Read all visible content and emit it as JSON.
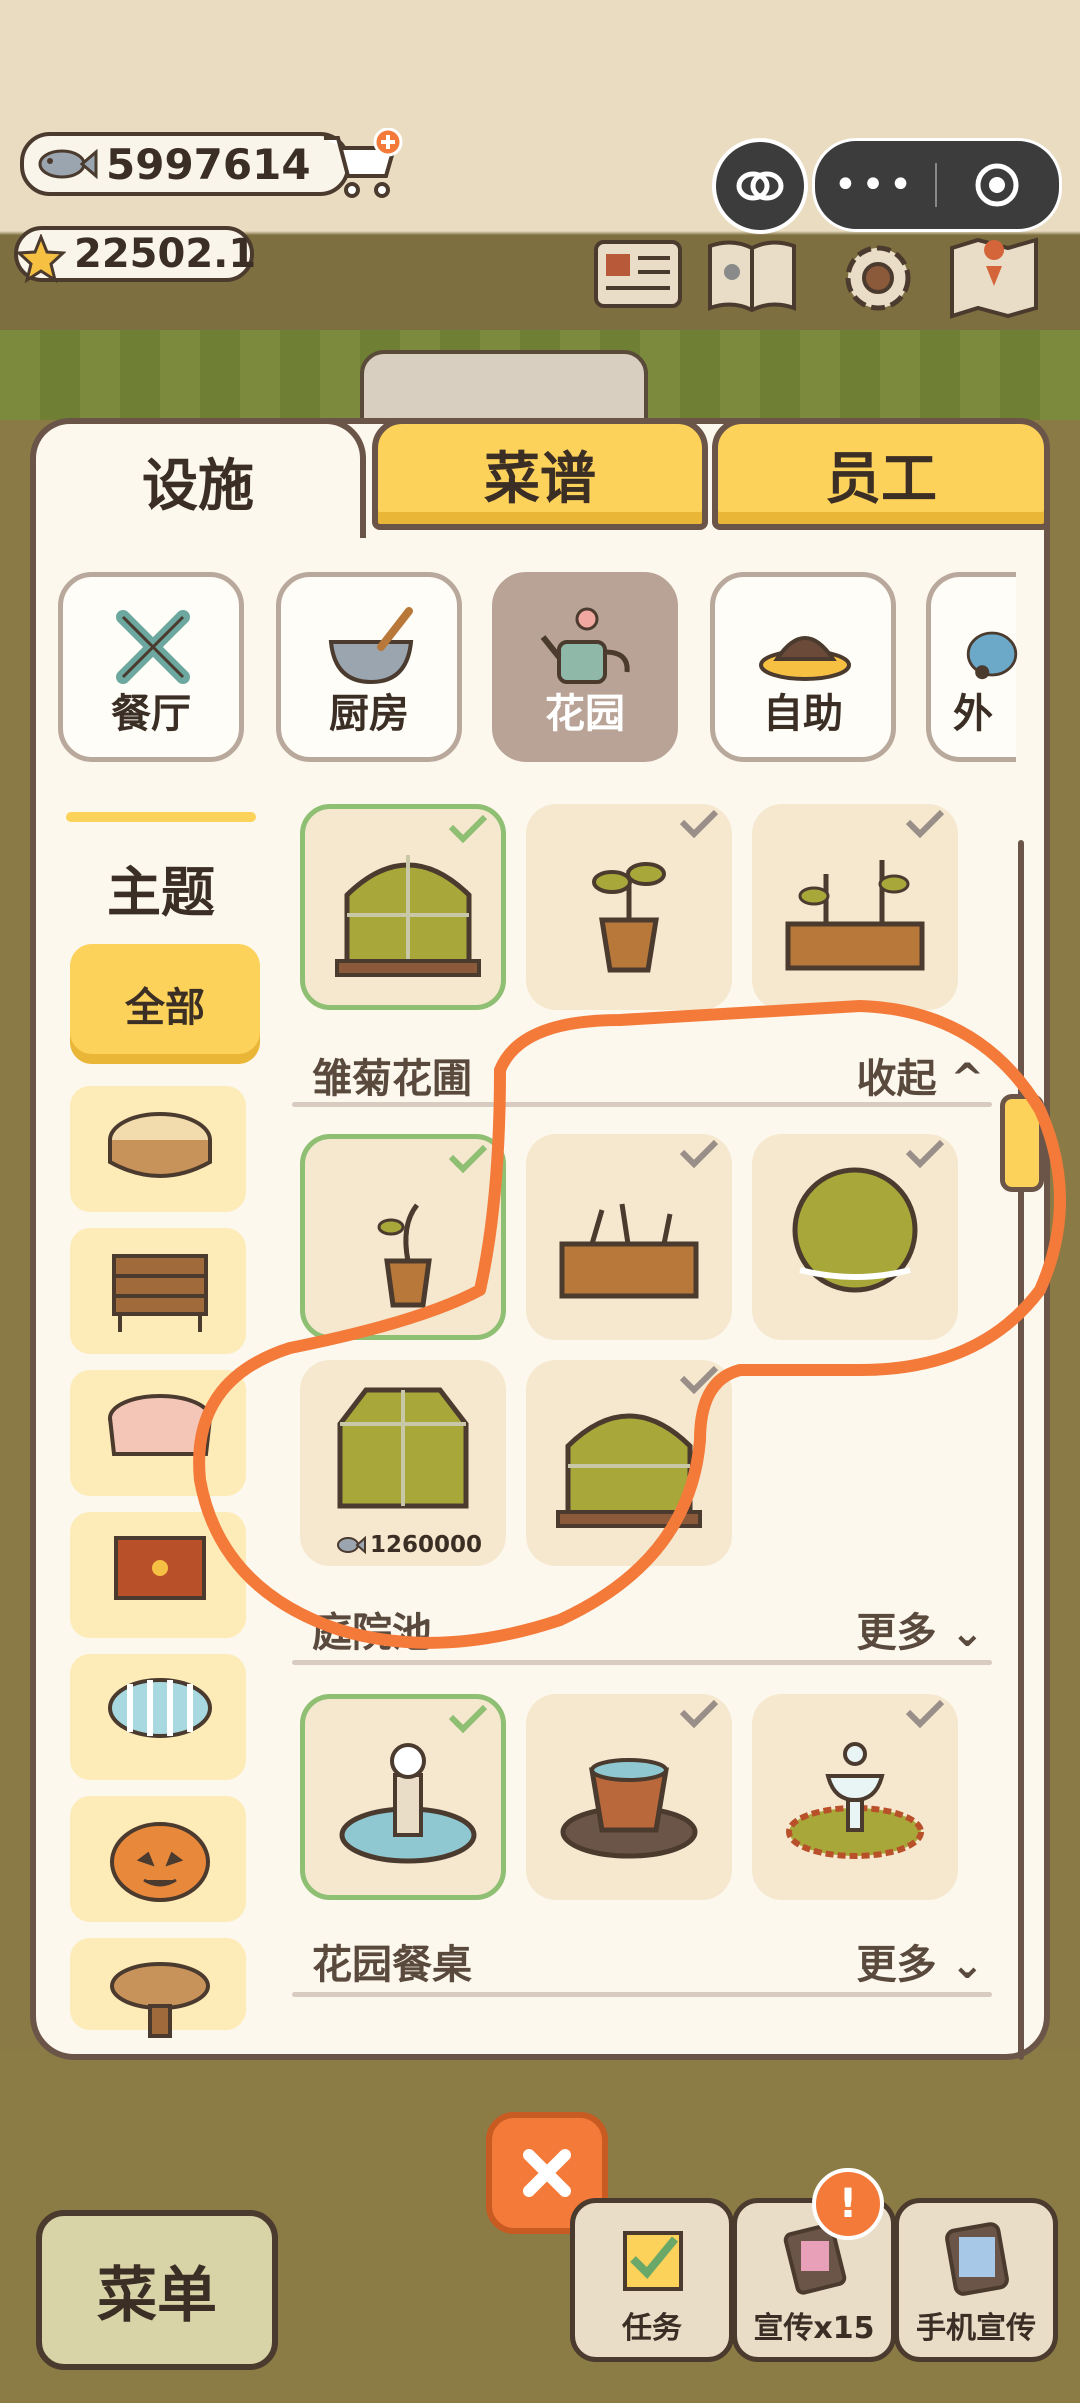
{
  "hud": {
    "currency_value": "5997614",
    "stars_value": "22502.1"
  },
  "tabs": [
    {
      "label": "设施",
      "active": true
    },
    {
      "label": "菜谱",
      "active": false
    },
    {
      "label": "员工",
      "active": false
    }
  ],
  "categories": [
    {
      "label": "餐厅",
      "selected": false
    },
    {
      "label": "厨房",
      "selected": false
    },
    {
      "label": "花园",
      "selected": true
    },
    {
      "label": "自助",
      "selected": false
    },
    {
      "label": "外",
      "selected": false
    }
  ],
  "sidebar": {
    "title": "主题",
    "all_label": "全部"
  },
  "rows": [
    {
      "label": "雏菊花圃",
      "action": "收起"
    },
    {
      "label": "庭院池",
      "action": "更多"
    },
    {
      "label": "花园餐桌",
      "action": "更多"
    }
  ],
  "price_value": "1260000",
  "bottom": {
    "menu_label": "菜单",
    "tasks_label": "任务",
    "promo_label": "宣传x15",
    "phone_promo_label": "手机宣传",
    "badge": "!"
  },
  "colors": {
    "panel_border": "#6b5548",
    "tab_yellow": "#fdd25a",
    "owned_border": "#8fbf72",
    "annotation_orange": "#f47a3a"
  }
}
